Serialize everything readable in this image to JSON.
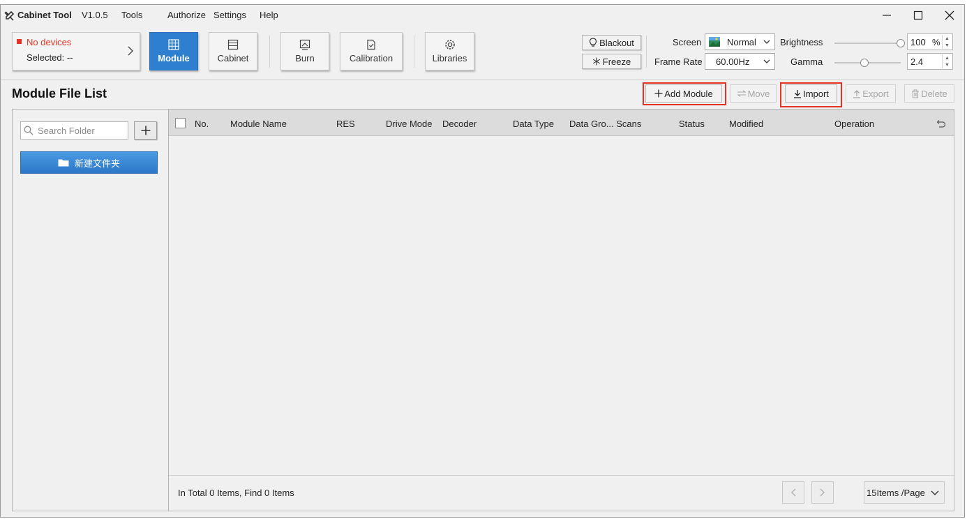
{
  "titlebar": {
    "app_title": "Cabinet Tool",
    "version": "V1.0.5",
    "menu": [
      "Tools",
      "Authorize",
      "Settings",
      "Help"
    ]
  },
  "toolbar": {
    "device_status": "No devices",
    "device_selected": "Selected: --",
    "buttons": {
      "module": "Module",
      "cabinet": "Cabinet",
      "burn": "Burn",
      "calibration": "Calibration",
      "libraries": "Libraries"
    },
    "blackout": "Blackout",
    "freeze": "Freeze",
    "screen_label": "Screen",
    "screen_value": "Normal",
    "frame_rate_label": "Frame Rate",
    "frame_rate_value": "60.00Hz",
    "brightness_label": "Brightness",
    "brightness_value": "100",
    "brightness_unit": "%",
    "brightness_level": 1.0,
    "gamma_label": "Gamma",
    "gamma_value": "2.4",
    "gamma_level": 0.45
  },
  "main": {
    "title": "Module File List",
    "actions": {
      "add_module": "Add Module",
      "move": "Move",
      "import": "Import",
      "export": "Export",
      "delete": "Delete"
    },
    "search_placeholder": "Search Folder",
    "folder_name": "新建文件夹",
    "columns": [
      "No.",
      "Module Name",
      "RES",
      "Drive Mode",
      "Decoder",
      "Data Type",
      "Data Gro... Scans",
      "Status",
      "Modified",
      "Operation"
    ],
    "rows": [],
    "footer_text": "In Total 0 Items, Find 0 Items",
    "page_size": "15Items /Page"
  },
  "colors": {
    "accent": "#2f7fd0",
    "status_red": "#e53222",
    "highlight": "#e53222"
  }
}
